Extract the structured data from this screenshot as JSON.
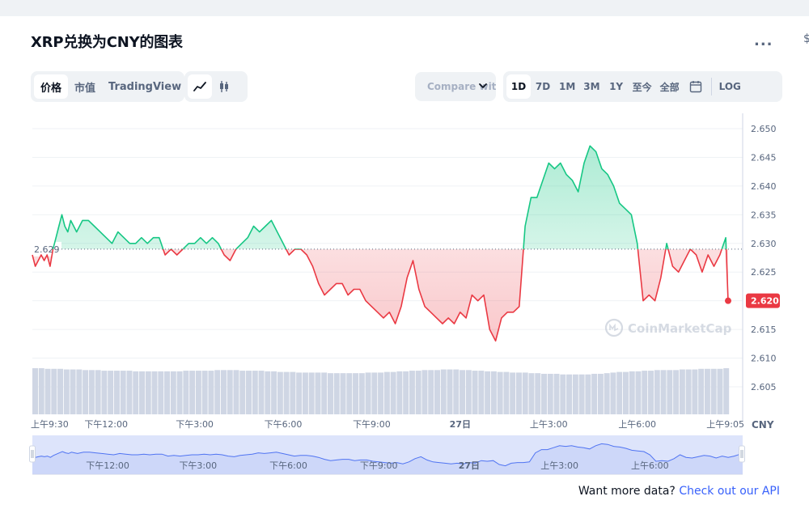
{
  "header": {
    "title": "XRP兑换为CNY的图表",
    "more_label": "...",
    "edge_label": "$"
  },
  "view_tabs": [
    {
      "label": "价格",
      "active": true
    },
    {
      "label": "市值",
      "active": false
    },
    {
      "label": "TradingView",
      "active": false
    }
  ],
  "chart_type_icons": [
    {
      "name": "line-chart-icon",
      "active": true
    },
    {
      "name": "candlestick-icon",
      "active": false
    }
  ],
  "compare": {
    "label": "Compare with"
  },
  "ranges": [
    {
      "label": "1D",
      "active": true
    },
    {
      "label": "7D",
      "active": false
    },
    {
      "label": "1M",
      "active": false
    },
    {
      "label": "3M",
      "active": false
    },
    {
      "label": "1Y",
      "active": false
    },
    {
      "label": "至今",
      "active": false
    },
    {
      "label": "全部",
      "active": false
    }
  ],
  "log_label": "LOG",
  "footer": {
    "text": "Want more data?",
    "link": "Check out our API"
  },
  "watermark": "CoinMarketCap",
  "colors": {
    "up": "#16c784",
    "down": "#ea3943",
    "grid": "#eff2f5",
    "volume": "#cfd6e4",
    "navigator_fill": "#dde4fb",
    "navigator_line": "#5074f2",
    "accent": "#3861fb"
  },
  "chart_data": {
    "type": "line",
    "currency_label": "CNY",
    "baseline": 2.629,
    "baseline_label": "2.629",
    "current_value": 2.62,
    "current_label": "2.620",
    "ylim": [
      2.6,
      2.652
    ],
    "y_ticks": [
      "2.650",
      "2.645",
      "2.640",
      "2.635",
      "2.630",
      "2.625",
      "2.620",
      "2.615",
      "2.610",
      "2.605"
    ],
    "x_range_hours": [
      9.5,
      33.08
    ],
    "x_ticks": [
      {
        "label": "上午9:30",
        "t": 9.5
      },
      {
        "label": "下午12:00",
        "t": 12
      },
      {
        "label": "下午3:00",
        "t": 15
      },
      {
        "label": "下午6:00",
        "t": 18
      },
      {
        "label": "下午9:00",
        "t": 21
      },
      {
        "label": "27日",
        "t": 24
      },
      {
        "label": "上午3:00",
        "t": 27
      },
      {
        "label": "上午6:00",
        "t": 30
      },
      {
        "label": "上午9:05",
        "t": 33.08
      }
    ],
    "navigator_ticks": [
      {
        "label": "下午12:00",
        "t": 12
      },
      {
        "label": "下午3:00",
        "t": 15
      },
      {
        "label": "下午6:00",
        "t": 18
      },
      {
        "label": "下午9:00",
        "t": 21
      },
      {
        "label": "27日",
        "t": 24
      },
      {
        "label": "上午3:00",
        "t": 27
      },
      {
        "label": "上午6:00",
        "t": 30
      }
    ],
    "series": [
      {
        "t": [
          9.5,
          9.6,
          9.7,
          9.8,
          9.9,
          10.0,
          10.1,
          10.2,
          10.3,
          10.4,
          10.5,
          10.6,
          10.7,
          10.8,
          10.9,
          11.0,
          11.2,
          11.4,
          11.6,
          11.8,
          12.0,
          12.2,
          12.4,
          12.6,
          12.8,
          13.0,
          13.2,
          13.4,
          13.6,
          13.8,
          14.0,
          14.2,
          14.4,
          14.6,
          14.8,
          15.0,
          15.2,
          15.4,
          15.6,
          15.8,
          16.0,
          16.2,
          16.4,
          16.6,
          16.8,
          17.0,
          17.2,
          17.4,
          17.6,
          17.8,
          18.0,
          18.2,
          18.4,
          18.6,
          18.8,
          19.0,
          19.2,
          19.4,
          19.6,
          19.8,
          20.0,
          20.2,
          20.4,
          20.6,
          20.8,
          21.0,
          21.2,
          21.4,
          21.6,
          21.8,
          22.0,
          22.2,
          22.4,
          22.6,
          22.8,
          23.0,
          23.2,
          23.4,
          23.6,
          23.8,
          24.0,
          24.2,
          24.4,
          24.6,
          24.8,
          25.0,
          25.2,
          25.4,
          25.6,
          25.8,
          26.0,
          26.2,
          26.4,
          26.6,
          26.8,
          27.0,
          27.2,
          27.4,
          27.6,
          27.8,
          28.0,
          28.2,
          28.4,
          28.6,
          28.8,
          29.0,
          29.2,
          29.4,
          29.6,
          29.8,
          30.0,
          30.2,
          30.4,
          30.6,
          30.8,
          31.0,
          31.2,
          31.4,
          31.6,
          31.8,
          32.0,
          32.2,
          32.4,
          32.6,
          32.8,
          33.0,
          33.08
        ],
        "v": [
          2.628,
          2.626,
          2.627,
          2.628,
          2.627,
          2.628,
          2.626,
          2.629,
          2.631,
          2.633,
          2.635,
          2.633,
          2.632,
          2.634,
          2.633,
          2.632,
          2.634,
          2.634,
          2.633,
          2.632,
          2.631,
          2.63,
          2.632,
          2.631,
          2.63,
          2.63,
          2.631,
          2.63,
          2.631,
          2.631,
          2.628,
          2.629,
          2.628,
          2.629,
          2.63,
          2.63,
          2.631,
          2.63,
          2.631,
          2.63,
          2.628,
          2.627,
          2.629,
          2.63,
          2.631,
          2.633,
          2.632,
          2.633,
          2.634,
          2.632,
          2.63,
          2.628,
          2.629,
          2.629,
          2.628,
          2.626,
          2.623,
          2.621,
          2.622,
          2.623,
          2.623,
          2.621,
          2.622,
          2.622,
          2.62,
          2.619,
          2.618,
          2.617,
          2.618,
          2.616,
          2.619,
          2.624,
          2.627,
          2.622,
          2.619,
          2.618,
          2.617,
          2.616,
          2.617,
          2.616,
          2.618,
          2.617,
          2.621,
          2.62,
          2.621,
          2.615,
          2.613,
          2.617,
          2.618,
          2.618,
          2.619,
          2.633,
          2.638,
          2.638,
          2.641,
          2.644,
          2.643,
          2.644,
          2.642,
          2.641,
          2.639,
          2.644,
          2.647,
          2.646,
          2.643,
          2.642,
          2.64,
          2.637,
          2.636,
          2.635,
          2.63,
          2.62,
          2.621,
          2.62,
          2.624,
          2.63,
          2.626,
          2.625,
          2.627,
          2.629,
          2.628,
          2.625,
          2.628,
          2.626,
          2.628,
          2.631,
          2.62
        ]
      }
    ],
    "volume": [
      74,
      74,
      73,
      73,
      73,
      72,
      72,
      72,
      71,
      71,
      71,
      70,
      70,
      70,
      70,
      70,
      69,
      69,
      69,
      69,
      69,
      69,
      69,
      69,
      70,
      70,
      70,
      70,
      70,
      71,
      71,
      71,
      71,
      70,
      70,
      70,
      70,
      69,
      69,
      68,
      68,
      68,
      67,
      67,
      67,
      67,
      67,
      66,
      66,
      66,
      66,
      66,
      66,
      67,
      67,
      67,
      68,
      68,
      69,
      69,
      70,
      70,
      71,
      71,
      71,
      72,
      72,
      72,
      71,
      71,
      70,
      70,
      69,
      69,
      68,
      68,
      67,
      67,
      67,
      66,
      66,
      65,
      65,
      65,
      64,
      64,
      64,
      64,
      64,
      65,
      65,
      66,
      67,
      68,
      68,
      69,
      69,
      70,
      70,
      71,
      71,
      71,
      71,
      72,
      72,
      72,
      73,
      73,
      73,
      73,
      74
    ]
  }
}
